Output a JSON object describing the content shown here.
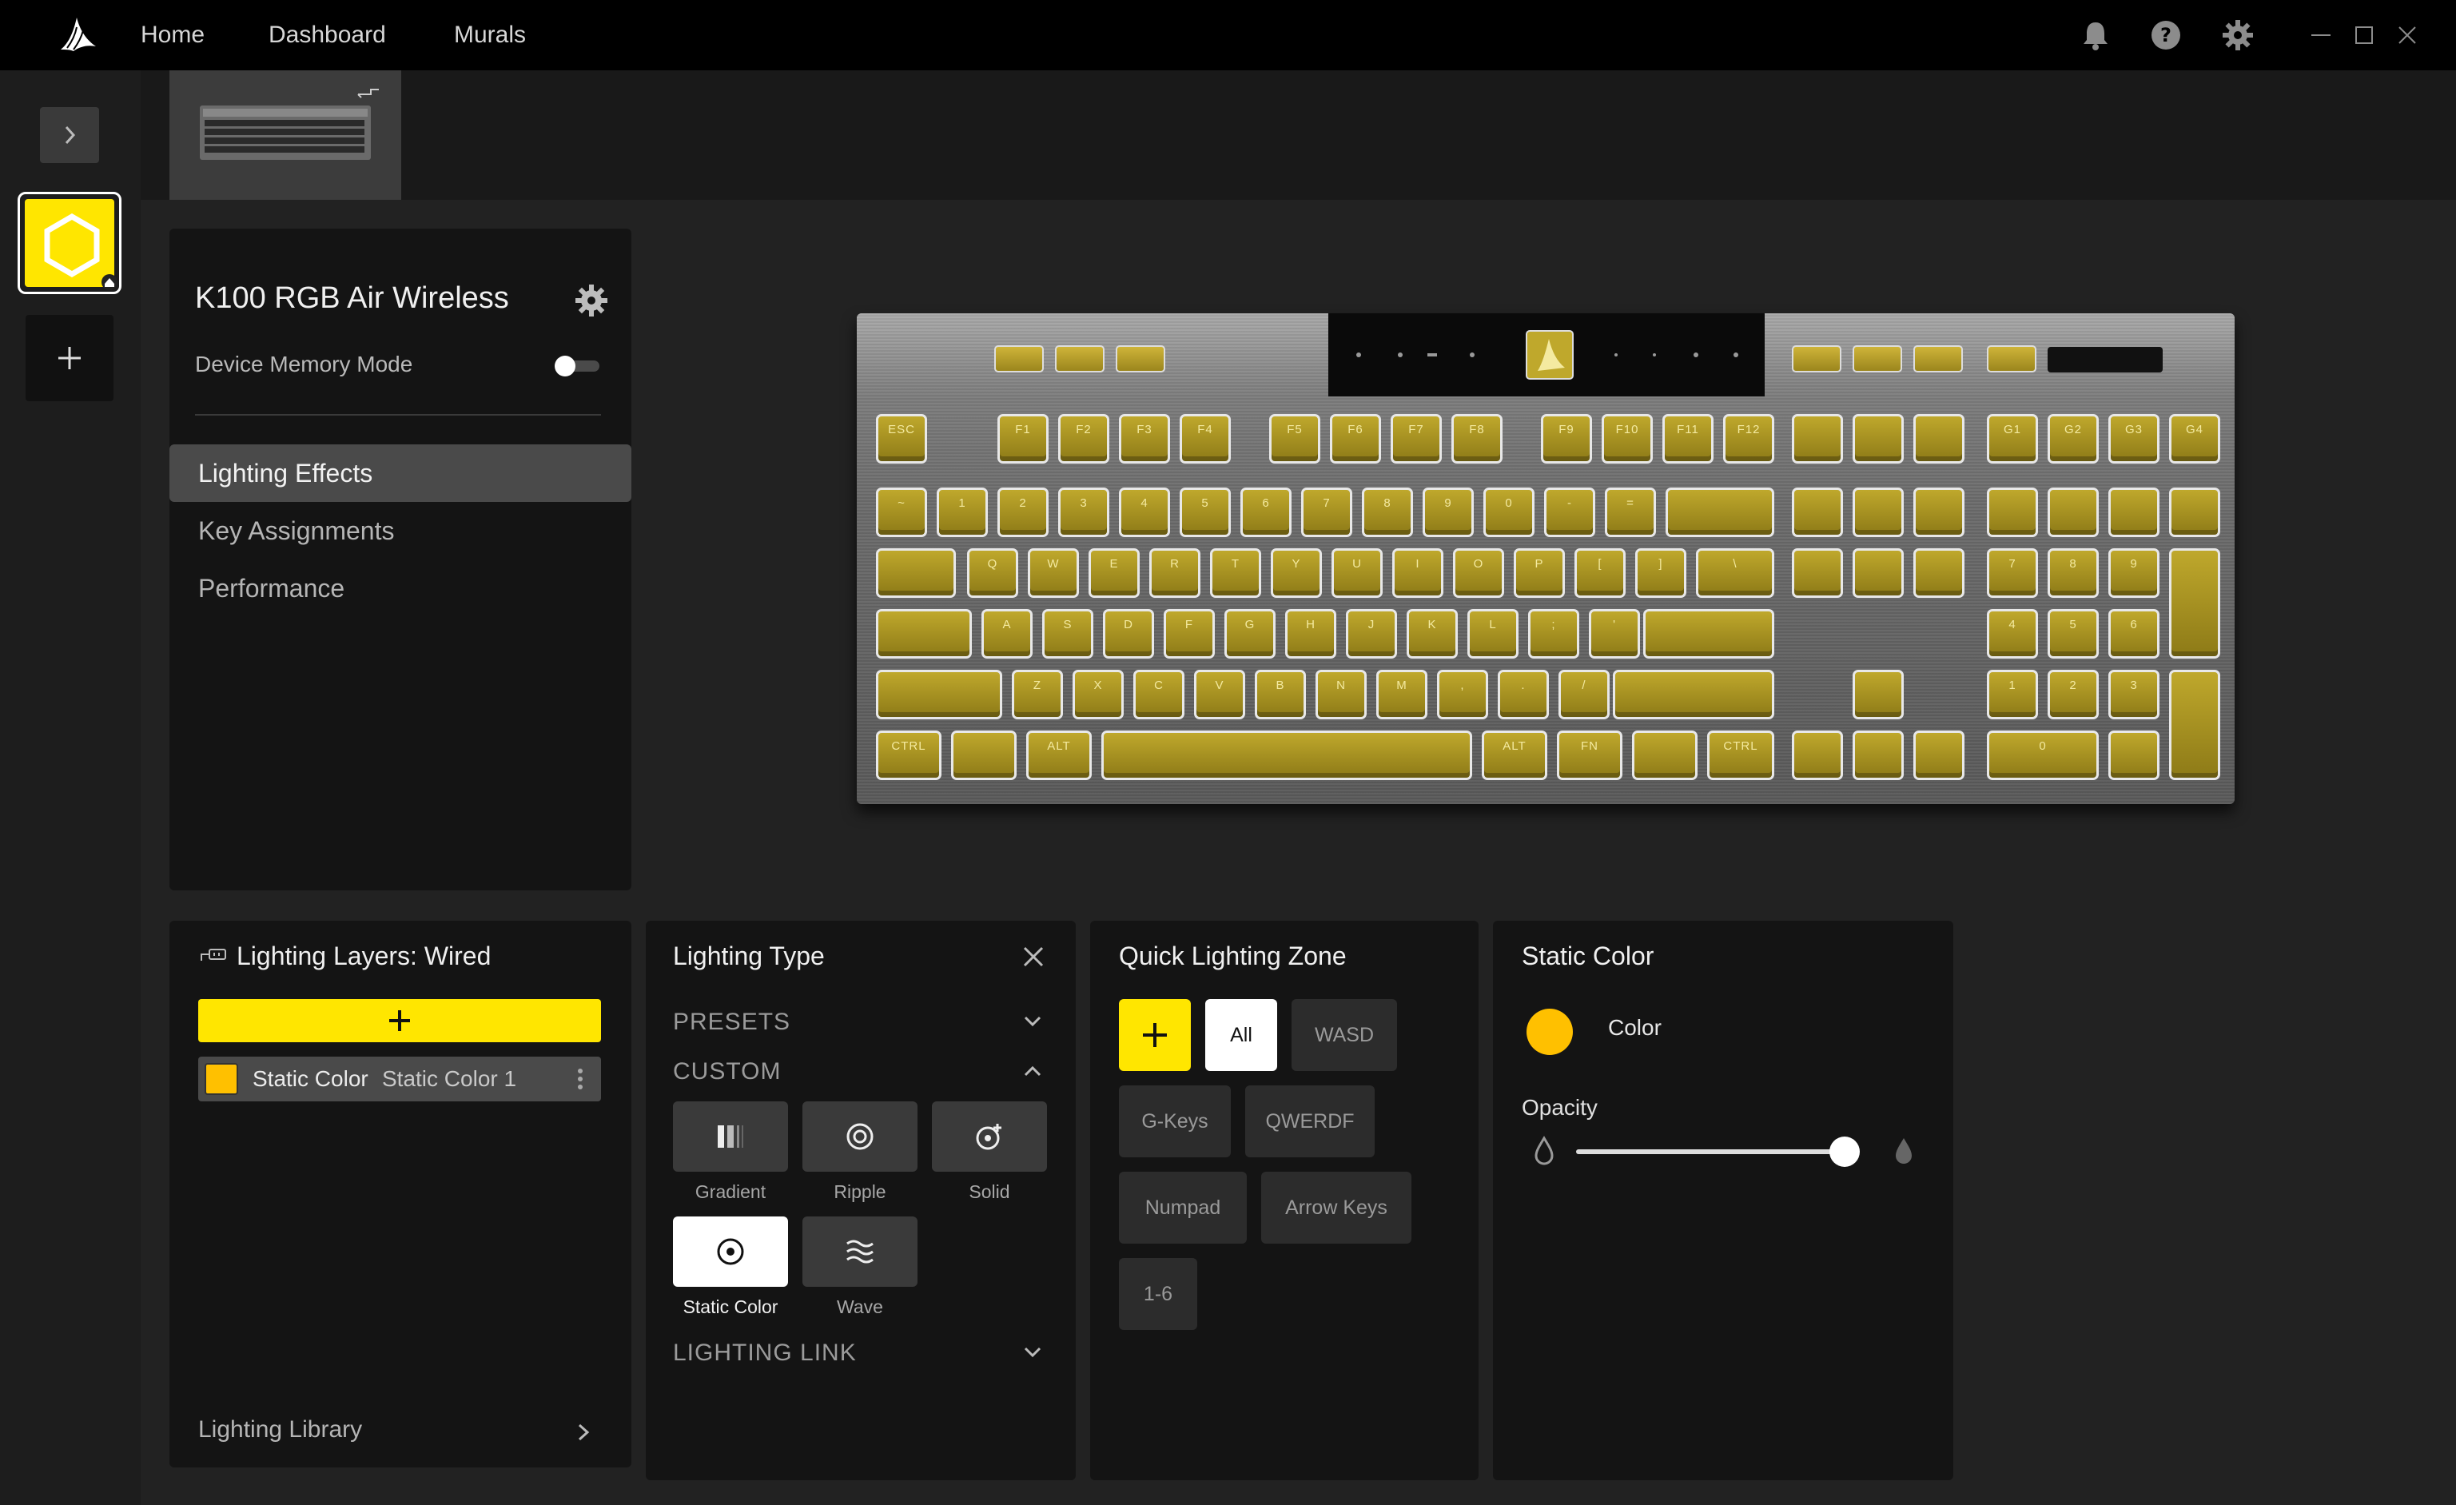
{
  "nav": {
    "home": "Home",
    "dashboard": "Dashboard",
    "murals": "Murals"
  },
  "device": {
    "name": "K100 RGB Air Wireless",
    "memory_mode_label": "Device Memory Mode",
    "memory_mode_on": false
  },
  "menu": {
    "items": [
      {
        "label": "Lighting Effects",
        "active": true
      },
      {
        "label": "Key Assignments",
        "active": false
      },
      {
        "label": "Performance",
        "active": false
      }
    ]
  },
  "layers": {
    "title": "Lighting Layers: Wired",
    "items": [
      {
        "name": "Static Color",
        "sub": "Static Color 1",
        "color": "#ffc000"
      }
    ],
    "library_label": "Lighting Library"
  },
  "lighting_type": {
    "title": "Lighting Type",
    "presets_label": "PRESETS",
    "custom_label": "CUSTOM",
    "link_label": "LIGHTING LINK",
    "tiles": [
      {
        "label": "Gradient",
        "icon": "gradient-icon",
        "active": false
      },
      {
        "label": "Ripple",
        "icon": "ripple-icon",
        "active": false
      },
      {
        "label": "Solid",
        "icon": "solid-icon",
        "active": false
      },
      {
        "label": "Static Color",
        "icon": "static-color-icon",
        "active": true
      },
      {
        "label": "Wave",
        "icon": "wave-icon",
        "active": false
      }
    ]
  },
  "zone": {
    "title": "Quick Lighting Zone",
    "all": "All",
    "wasd": "WASD",
    "gkeys": "G-Keys",
    "qwerdf": "QWERDF",
    "numpad": "Numpad",
    "arrows": "Arrow Keys",
    "onesix": "1-6"
  },
  "static_color": {
    "title": "Static Color",
    "color_label": "Color",
    "color": "#ffc000",
    "opacity_label": "Opacity",
    "opacity": 0.95
  },
  "keyboard": {
    "fn_row": [
      "ESC",
      "F1",
      "F2",
      "F3",
      "F4",
      "F5",
      "F6",
      "F7",
      "F8",
      "F9",
      "F10",
      "F11",
      "F12"
    ],
    "g_row": [
      "G1",
      "G2",
      "G3",
      "G4"
    ],
    "num_row": [
      "~",
      "1",
      "2",
      "3",
      "4",
      "5",
      "6",
      "7",
      "8",
      "9",
      "0",
      "-",
      "="
    ],
    "q_row": [
      "Q",
      "W",
      "E",
      "R",
      "T",
      "Y",
      "U",
      "I",
      "O",
      "P",
      "[",
      "]",
      "\\"
    ],
    "a_row": [
      "A",
      "S",
      "D",
      "F",
      "G",
      "H",
      "J",
      "K",
      "L",
      ";",
      "'"
    ],
    "z_row": [
      "Z",
      "X",
      "C",
      "V",
      "B",
      "N",
      "M",
      ",",
      ".",
      "/"
    ],
    "ctrl": "CTRL",
    "alt": "ALT",
    "fn": "FN",
    "numpad_digits": [
      "7",
      "8",
      "9",
      "4",
      "5",
      "6",
      "1",
      "2",
      "3",
      "0"
    ]
  },
  "colors": {
    "accent": "#ffe600",
    "key_color": "#ffc000"
  }
}
